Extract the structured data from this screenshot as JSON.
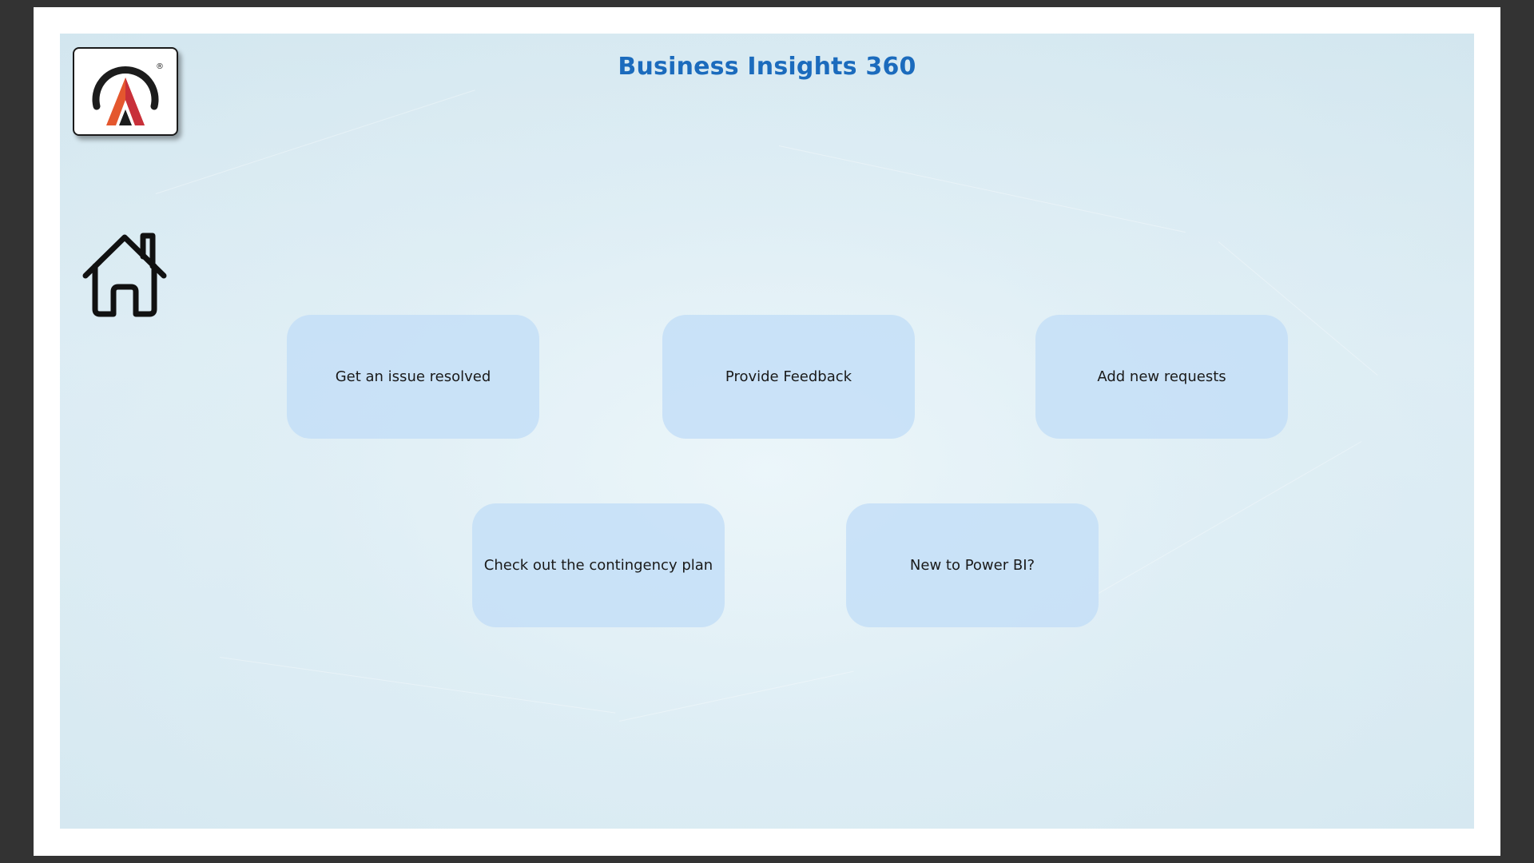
{
  "page": {
    "title": "Business Insights 360",
    "title_color": "#1b6bbd"
  },
  "logo": {
    "icon": "atliq-logo",
    "registered_mark": "®",
    "colors": [
      "#e4572e",
      "#c8303a",
      "#1c1c1c"
    ]
  },
  "home": {
    "icon": "home-icon"
  },
  "tiles": [
    {
      "label": "Get an issue resolved"
    },
    {
      "label": "Provide Feedback"
    },
    {
      "label": "Add new requests"
    },
    {
      "label": "Check out the contingency plan"
    },
    {
      "label": "New to Power BI?"
    }
  ],
  "colors": {
    "tile_background": "#c5dff7",
    "canvas_background": "#dcecf3"
  }
}
